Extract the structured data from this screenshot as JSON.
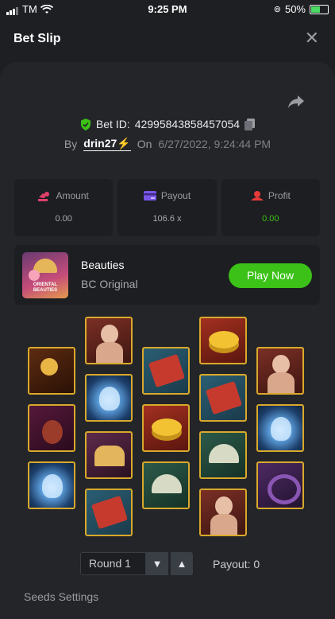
{
  "status_bar": {
    "carrier": "TM",
    "time": "9:25 PM",
    "battery": "50%"
  },
  "header": {
    "title": "Bet Slip",
    "close_glyph": "✕"
  },
  "bet": {
    "bet_id_label": "Bet ID:",
    "bet_id": "42995843858457054",
    "by_label": "By",
    "user": "drin27⚡",
    "on_label": "On",
    "date": "6/27/2022, 9:24:44 PM"
  },
  "stats": {
    "amount_label": "Amount",
    "amount_value": "0.00",
    "payout_label": "Payout",
    "payout_value": "106.6 x",
    "profit_label": "Profit",
    "profit_value": "0.00"
  },
  "game": {
    "name": "Beauties",
    "subtitle": "BC Original",
    "thumb_text": "ORIENTAL BEAUTIES",
    "play_label": "Play Now"
  },
  "reels": [
    [
      "hairpin",
      "pipa",
      "lotus"
    ],
    [
      "lady",
      "lotus",
      "comb",
      "book"
    ],
    [
      "book",
      "gold",
      "fan"
    ],
    [
      "gold",
      "book",
      "fan",
      "lady"
    ],
    [
      "lady",
      "lotus",
      "ring"
    ]
  ],
  "round": {
    "label": "Round 1",
    "payout_text": "Payout: 0"
  },
  "footer_peek": "Seeds Settings",
  "colors": {
    "accent_green": "#3bc117",
    "tile_border": "#d9a92b"
  },
  "icons": {
    "share": "share-icon",
    "shield": "shield-check-icon",
    "copy": "copy-icon",
    "amount": "amount-icon",
    "payout": "card-icon",
    "profit": "profit-icon"
  }
}
